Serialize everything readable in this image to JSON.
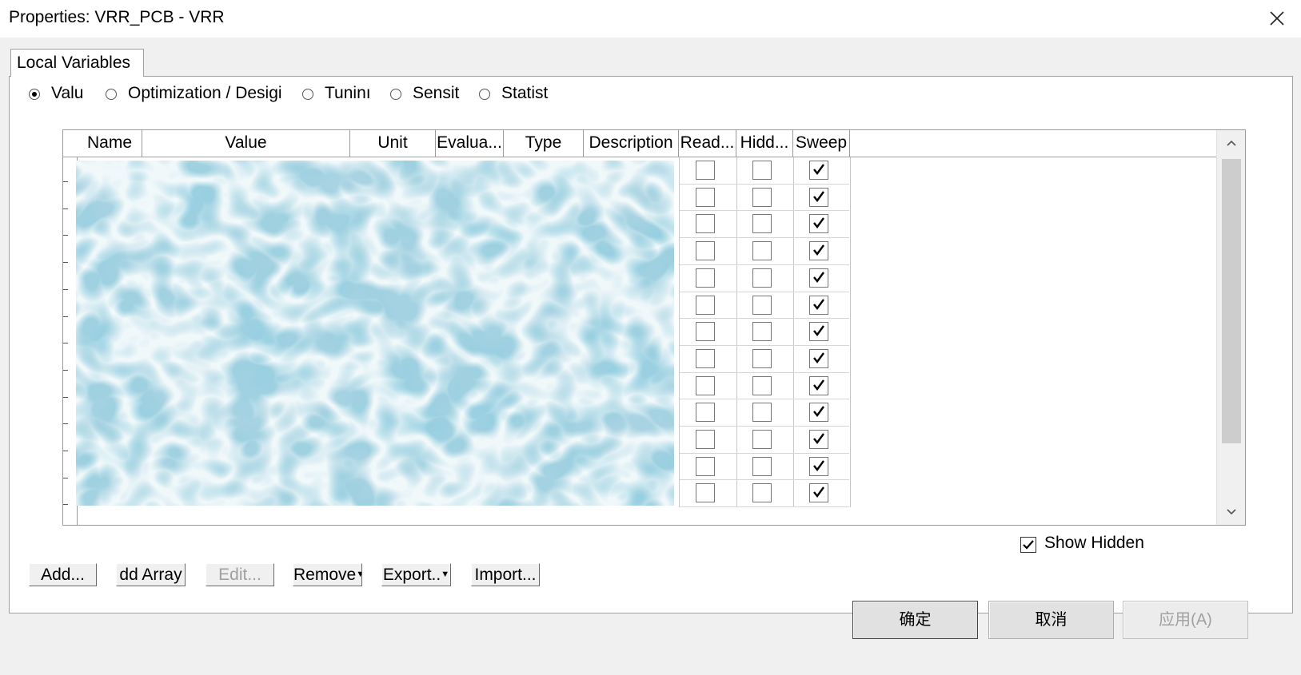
{
  "window": {
    "title": "Properties: VRR_PCB - VRR"
  },
  "tabs": [
    {
      "label": "Local Variables"
    }
  ],
  "mode_radios": [
    {
      "label": "Valu",
      "selected": true
    },
    {
      "label": "Optimization / Desigi",
      "selected": false
    },
    {
      "label": "Tuninı",
      "selected": false
    },
    {
      "label": "Sensit",
      "selected": false
    },
    {
      "label": "Statist",
      "selected": false
    }
  ],
  "table": {
    "columns": [
      "Name",
      "Value",
      "Unit",
      "Evalua...",
      "Type",
      "Description",
      "Read...",
      "Hidd...",
      "Sweep"
    ],
    "rows": [
      {
        "read": false,
        "hidden": false,
        "sweep": true
      },
      {
        "read": false,
        "hidden": false,
        "sweep": true
      },
      {
        "read": false,
        "hidden": false,
        "sweep": true
      },
      {
        "read": false,
        "hidden": false,
        "sweep": true
      },
      {
        "read": false,
        "hidden": false,
        "sweep": true
      },
      {
        "read": false,
        "hidden": false,
        "sweep": true
      },
      {
        "read": false,
        "hidden": false,
        "sweep": true
      },
      {
        "read": false,
        "hidden": false,
        "sweep": true
      },
      {
        "read": false,
        "hidden": false,
        "sweep": true
      },
      {
        "read": false,
        "hidden": false,
        "sweep": true
      },
      {
        "read": false,
        "hidden": false,
        "sweep": true
      },
      {
        "read": false,
        "hidden": false,
        "sweep": true
      },
      {
        "read": false,
        "hidden": false,
        "sweep": true
      }
    ]
  },
  "show_hidden": {
    "label": "Show Hidden",
    "checked": true
  },
  "action_buttons": {
    "add": "Add...",
    "add_array": "dd Array",
    "edit": "Edit...",
    "remove": "Remove",
    "export": "Export..",
    "import": "Import..."
  },
  "dialog_buttons": {
    "ok": "确定",
    "cancel": "取消",
    "apply": "应用(A)"
  }
}
